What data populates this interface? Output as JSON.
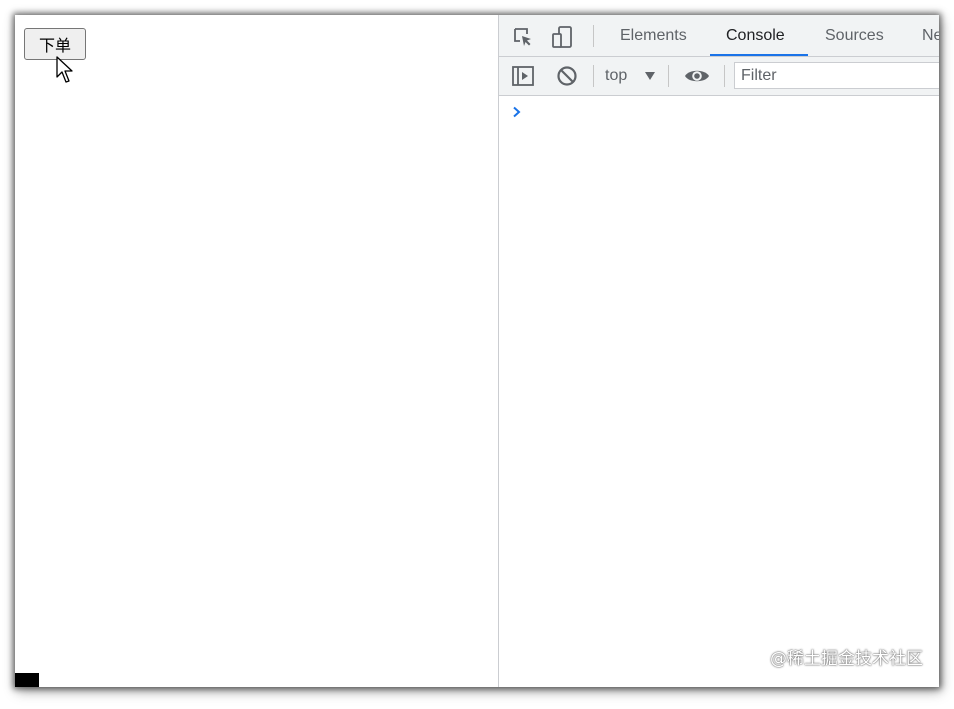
{
  "page": {
    "order_button_label": "下单"
  },
  "devtools": {
    "tabs": [
      {
        "label": "Elements",
        "active": false
      },
      {
        "label": "Console",
        "active": true
      },
      {
        "label": "Sources",
        "active": false
      },
      {
        "label": "Ne",
        "active": false
      }
    ],
    "context_selector": "top",
    "filter_placeholder": "Filter",
    "accent_color": "#1a73e8"
  },
  "watermark": "@稀土掘金技术社区"
}
